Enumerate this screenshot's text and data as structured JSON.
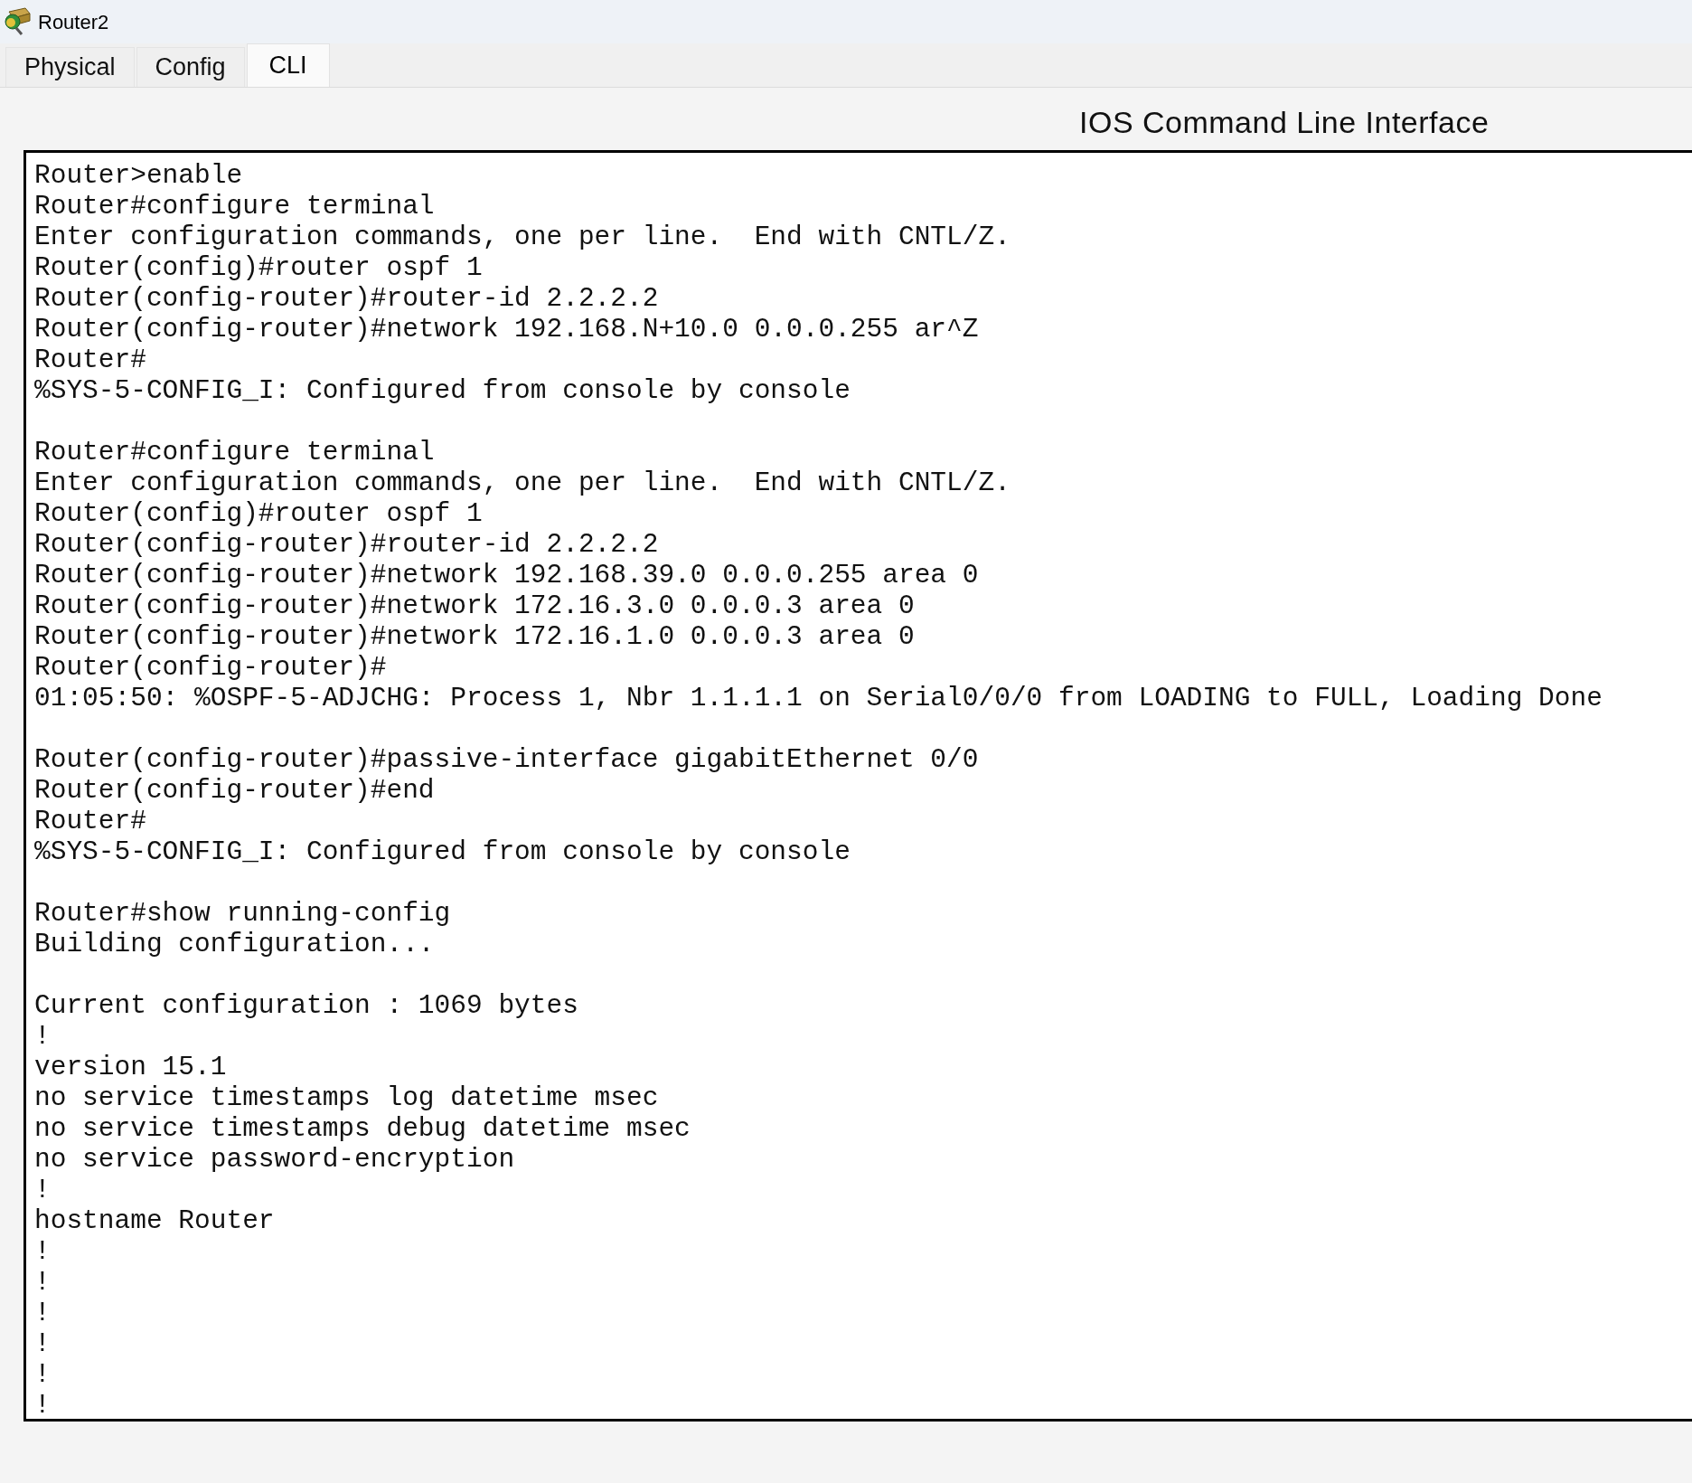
{
  "window": {
    "title": "Router2"
  },
  "tabs": [
    {
      "label": "Physical",
      "selected": false
    },
    {
      "label": "Config",
      "selected": false
    },
    {
      "label": "CLI",
      "selected": true
    }
  ],
  "cli": {
    "heading": "IOS Command Line Interface",
    "blocks": [
      [
        "Router>enable",
        "Router#configure terminal",
        "Enter configuration commands, one per line.  End with CNTL/Z.",
        "Router(config)#router ospf 1",
        "Router(config-router)#router-id 2.2.2.2",
        "Router(config-router)#network 192.168.N+10.0 0.0.0.255 ar^Z",
        "Router#",
        "%SYS-5-CONFIG_I: Configured from console by console"
      ],
      [
        "Router#configure terminal",
        "Enter configuration commands, one per line.  End with CNTL/Z.",
        "Router(config)#router ospf 1",
        "Router(config-router)#router-id 2.2.2.2",
        "Router(config-router)#network 192.168.39.0 0.0.0.255 area 0",
        "Router(config-router)#network 172.16.3.0 0.0.0.3 area 0",
        "Router(config-router)#network 172.16.1.0 0.0.0.3 area 0",
        "Router(config-router)#",
        "01:05:50: %OSPF-5-ADJCHG: Process 1, Nbr 1.1.1.1 on Serial0/0/0 from LOADING to FULL, Loading Done"
      ],
      [
        "Router(config-router)#passive-interface gigabitEthernet 0/0",
        "Router(config-router)#end",
        "Router#",
        "%SYS-5-CONFIG_I: Configured from console by console"
      ],
      [
        "Router#show running-config",
        "Building configuration..."
      ],
      [
        "Current configuration : 1069 bytes",
        "!",
        "version 15.1",
        "no service timestamps log datetime msec",
        "no service timestamps debug datetime msec",
        "no service password-encryption",
        "!",
        "hostname Router",
        "!",
        "!",
        "!",
        "!",
        "!",
        "!"
      ]
    ]
  }
}
